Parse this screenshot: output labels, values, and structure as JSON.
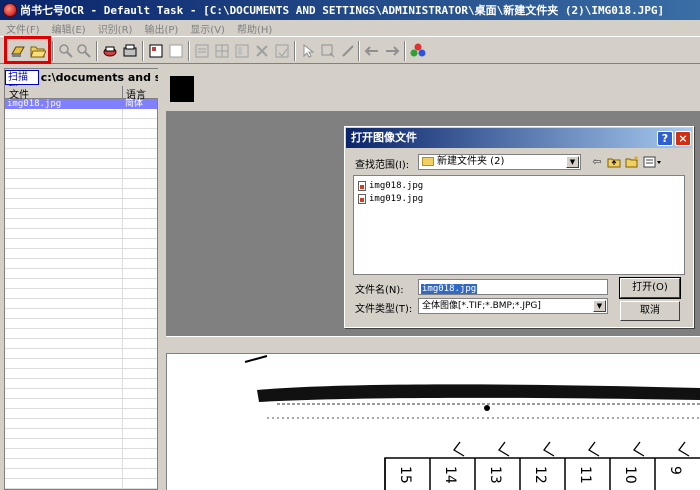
{
  "window": {
    "title": "尚书七号OCR - Default Task - [C:\\DOCUMENTS AND SETTINGS\\ADMINISTRATOR\\桌面\\新建文件夹 (2)\\IMG018.JPG]"
  },
  "menu": {
    "items": [
      "文件(F)",
      "编辑(E)",
      "识别(R)",
      "输出(P)",
      "显示(V)",
      "帮助(H)"
    ]
  },
  "toolbar": {
    "icons": [
      "scan-icon",
      "open-file-icon",
      "zoom-in-icon",
      "zoom-out-icon",
      "recognize-icon",
      "output-icon",
      "layout-icon",
      "layout-2-icon",
      "text-box-icon",
      "table-box-icon",
      "image-box-icon",
      "delete-box-icon",
      "save-box-icon",
      "select-icon",
      "rotate-icon",
      "pen-icon",
      "prev-icon",
      "next-icon",
      "color-icon"
    ]
  },
  "leftpanel": {
    "scan_label": "扫描到:",
    "scan_path": "c:\\documents and setti",
    "col_file": "文件",
    "col_lang": "语言",
    "files": [
      {
        "name": "img018.jpg",
        "lang": "简体"
      }
    ]
  },
  "dialog": {
    "title": "打开图像文件",
    "help": "?",
    "close": "×",
    "lookin_label": "查找范围(I):",
    "lookin_value": "新建文件夹 (2)",
    "files": [
      "img018.jpg",
      "img019.jpg"
    ],
    "filename_label": "文件名(N):",
    "filename_value": "img018.jpg",
    "filetype_label": "文件类型(T):",
    "filetype_value": "全体图像[*.TIF;*.BMP;*.JPG]",
    "open_label": "打开(O)",
    "cancel_label": "取消"
  },
  "document": {
    "column_numbers": [
      "15",
      "14",
      "13",
      "12",
      "11",
      "10",
      "9"
    ]
  }
}
